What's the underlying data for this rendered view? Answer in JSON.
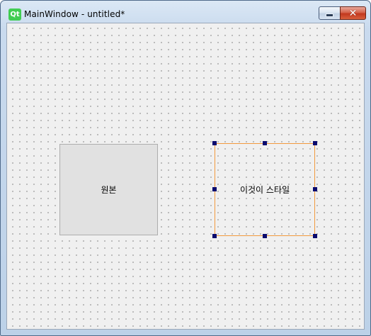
{
  "window": {
    "title": "MainWindow - untitled*",
    "logo_text": "Qt"
  },
  "titlebar_buttons": {
    "minimize": "minimize-icon",
    "close_label": "✕"
  },
  "form": {
    "widget_original_label": "원본",
    "widget_styled_label": "이것이 스타일"
  },
  "colors": {
    "selection_border": "#f29a3e",
    "selection_handle": "#0a0a6e",
    "widget_background": "#e1e1e1",
    "canvas_background": "#f0f0f0"
  }
}
